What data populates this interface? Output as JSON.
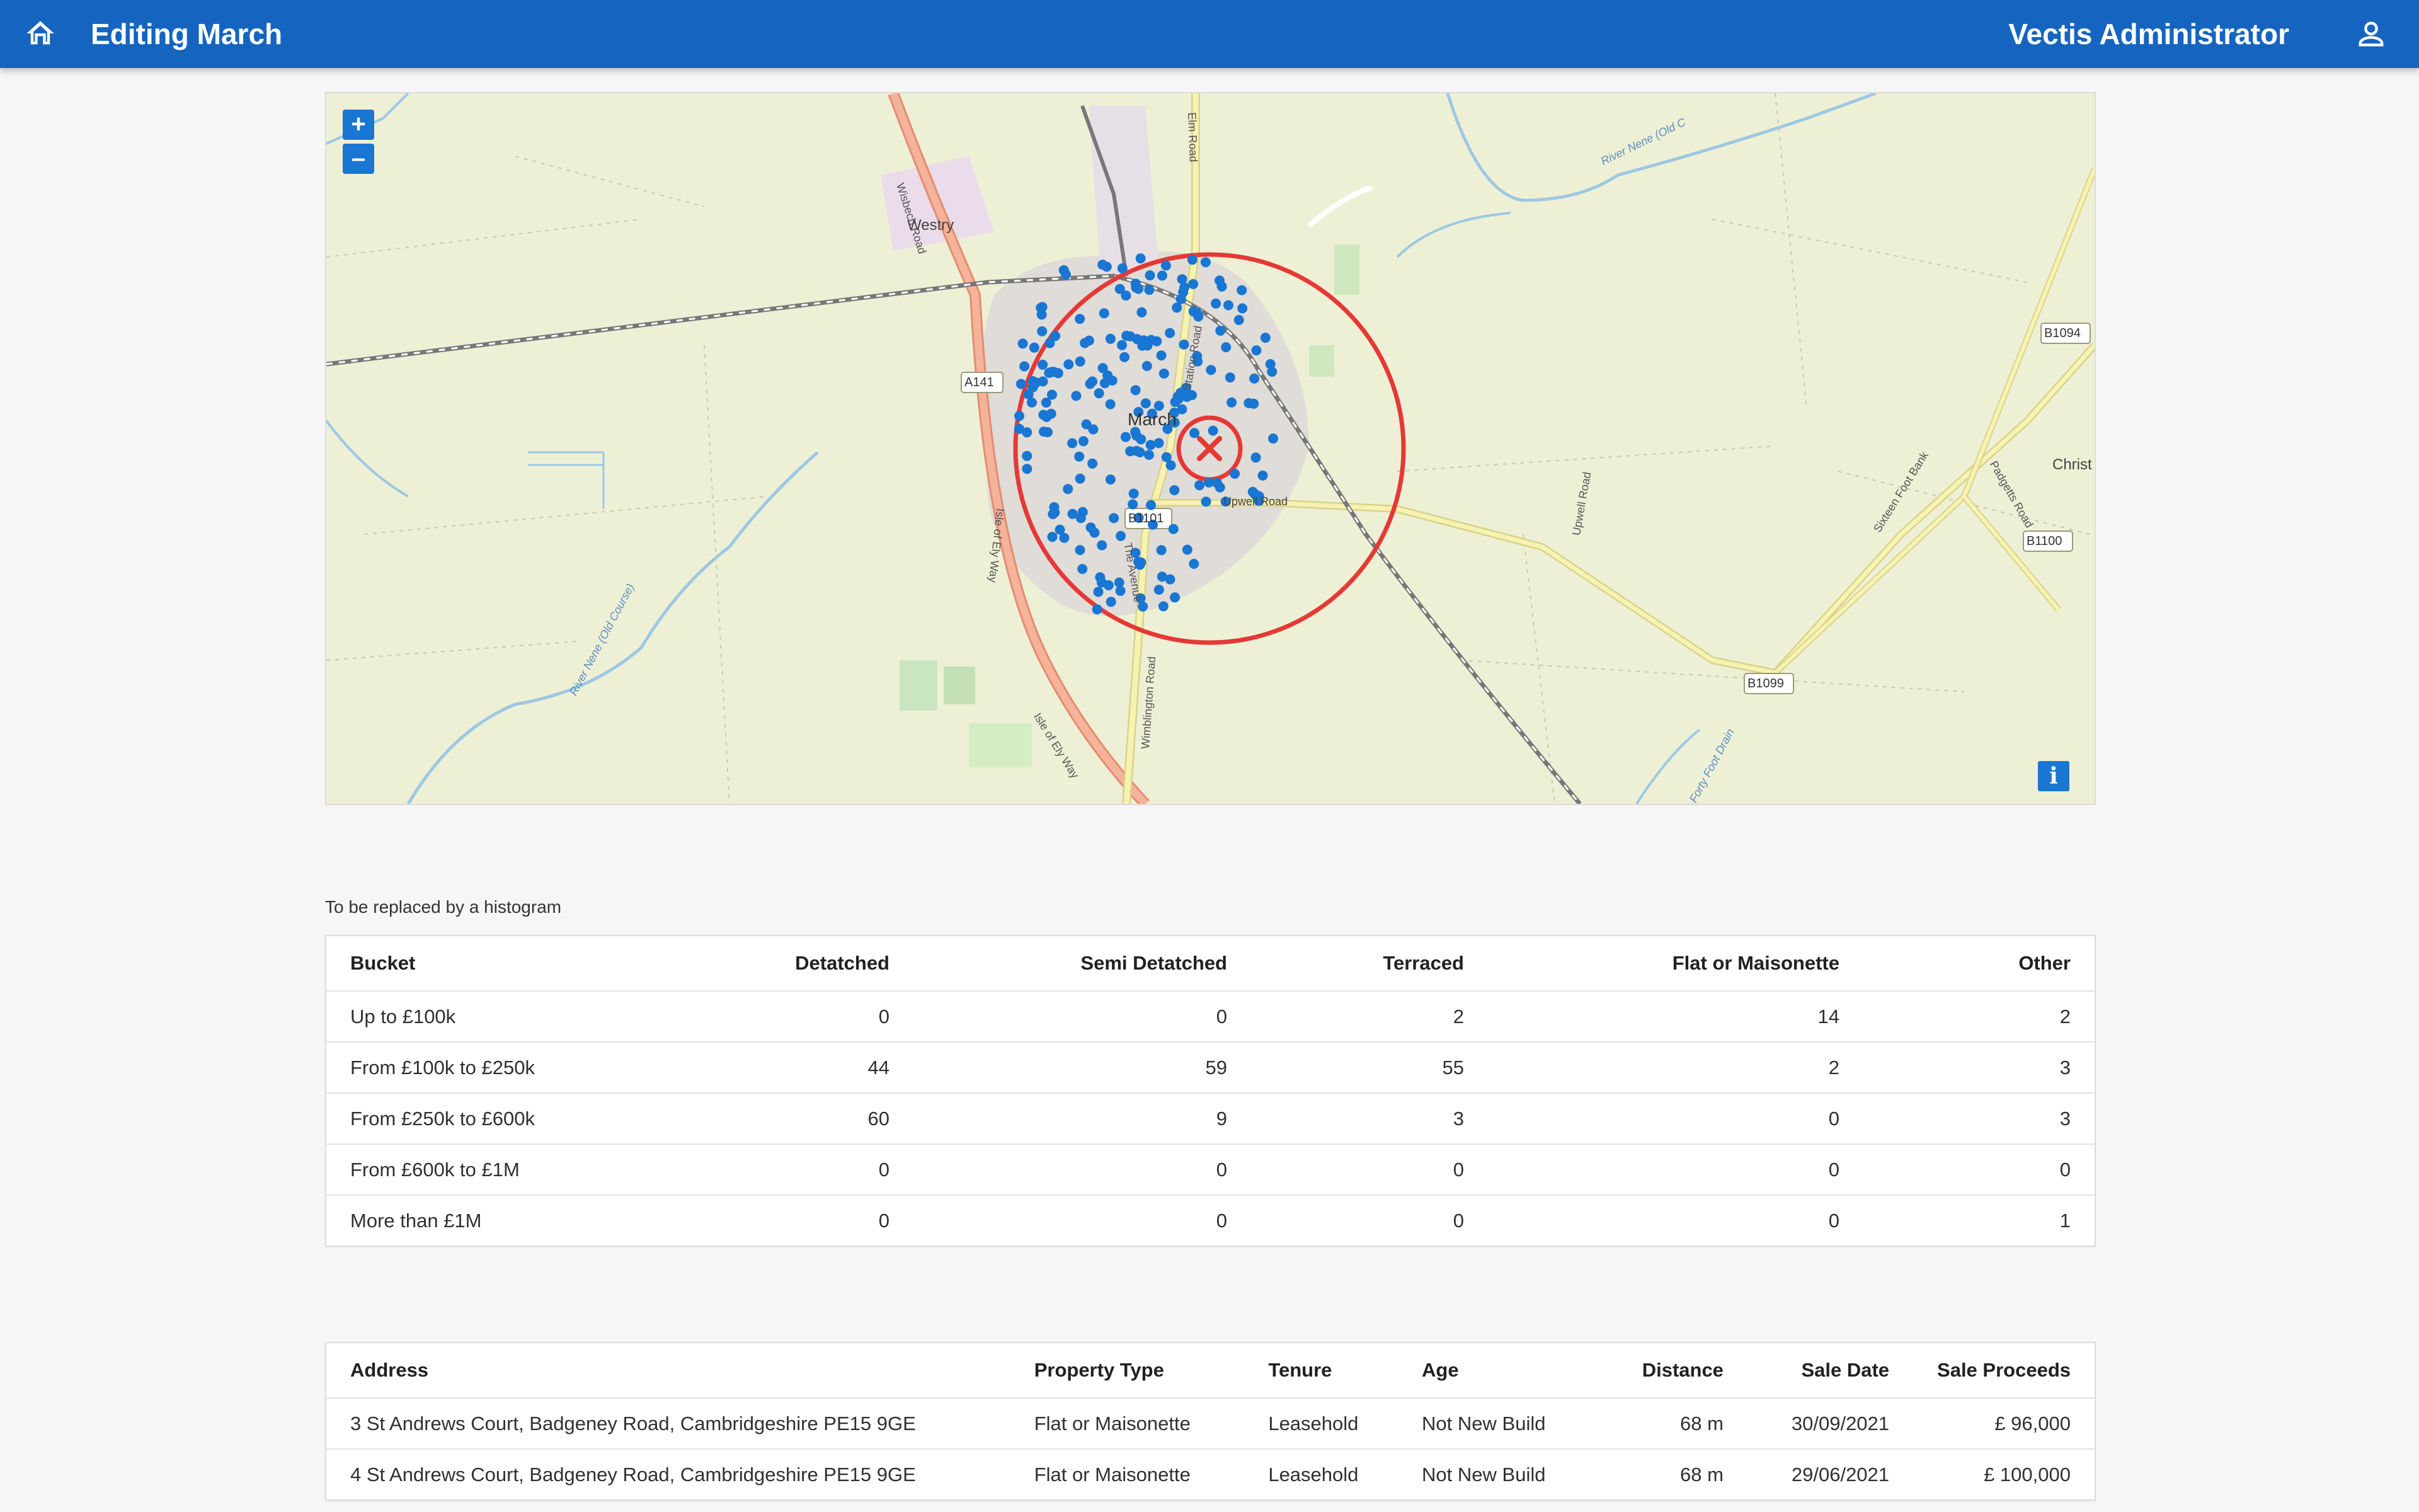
{
  "header": {
    "title": "Editing March",
    "user": "Vectis Administrator"
  },
  "map": {
    "zoom_in": "+",
    "zoom_out": "–",
    "info": "i",
    "labels": {
      "westry": "Westry",
      "march": "March",
      "christ": "Christ",
      "a141": "A141",
      "b1101": "B1101",
      "b1094": "B1094",
      "b1100": "B1100",
      "b1099": "B1099",
      "wisbech_road": "Wisbech Road",
      "elm_road": "Elm Road",
      "station_road": "Station Road",
      "upwell_road_1": "Upwell Road",
      "upwell_road_2": "Upwell Road",
      "isle_of_ely_way_1": "Isle of Ely Way",
      "isle_of_ely_way_2": "Isle of Ely Way",
      "the_avenue": "The Avenue",
      "wimblington_road": "Wimblington Road",
      "sixteen_foot_bank": "Sixteen Foot Bank",
      "padgetts_road": "Padgetts Road",
      "river_nene_old_course_1": "River Nene (Old Course)",
      "river_nene_old_course_2": "River Nene (Old C",
      "forty_foot_drain": "Forty Foot Drain"
    },
    "radius_ring_color": "#e53935",
    "point_color": "#1976d2"
  },
  "caption": "To be replaced by a histogram",
  "histogram": {
    "headers": [
      "Bucket",
      "Detatched",
      "Semi Detatched",
      "Terraced",
      "Flat or Maisonette",
      "Other"
    ],
    "rows": [
      [
        "Up to £100k",
        "0",
        "0",
        "2",
        "14",
        "2"
      ],
      [
        "From £100k to £250k",
        "44",
        "59",
        "55",
        "2",
        "3"
      ],
      [
        "From £250k to £600k",
        "60",
        "9",
        "3",
        "0",
        "3"
      ],
      [
        "From £600k to £1M",
        "0",
        "0",
        "0",
        "0",
        "0"
      ],
      [
        "More than £1M",
        "0",
        "0",
        "0",
        "0",
        "1"
      ]
    ]
  },
  "sales": {
    "headers": [
      "Address",
      "Property Type",
      "Tenure",
      "Age",
      "Distance",
      "Sale Date",
      "Sale Proceeds"
    ],
    "rows": [
      [
        "3 St Andrews Court, Badgeney Road, Cambridgeshire PE15 9GE",
        "Flat or Maisonette",
        "Leasehold",
        "Not New Build",
        "68 m",
        "30/09/2021",
        "£ 96,000"
      ],
      [
        "4 St Andrews Court, Badgeney Road, Cambridgeshire PE15 9GE",
        "Flat or Maisonette",
        "Leasehold",
        "Not New Build",
        "68 m",
        "29/06/2021",
        "£ 100,000"
      ]
    ]
  }
}
